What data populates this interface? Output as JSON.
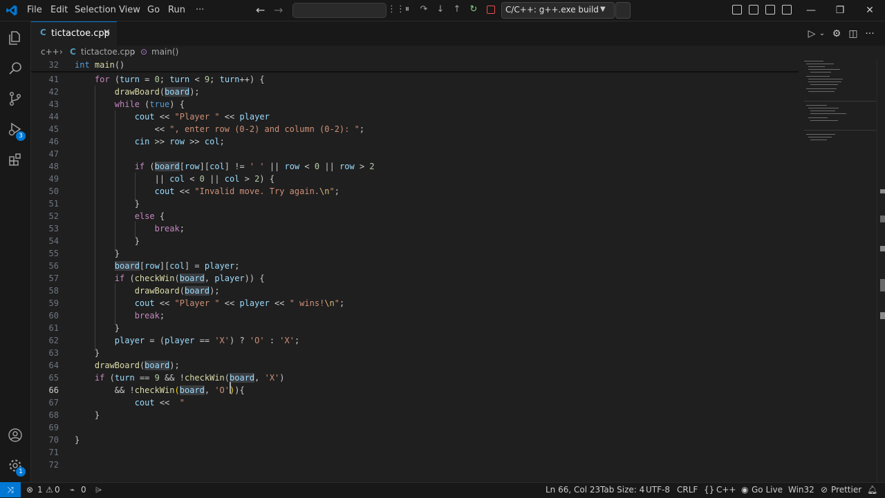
{
  "titlebar": {
    "menu": [
      "File",
      "Edit",
      "Selection",
      "View",
      "Go",
      "Run",
      "···"
    ],
    "run_config": "C/C++: g++.exe build a",
    "accent": "#0078d4"
  },
  "activity": {
    "run_debug_badge": "3",
    "manage_badge": "1"
  },
  "tab": {
    "label": "tictactoe.cpp",
    "icon": "C"
  },
  "breadcrumb": {
    "lang": "c++",
    "file": "tictactoe.cpp",
    "symbol": "main()"
  },
  "editor": {
    "sticky_line": "32",
    "line_numbers": [
      "41",
      "42",
      "43",
      "44",
      "45",
      "46",
      "47",
      "48",
      "49",
      "50",
      "51",
      "52",
      "53",
      "54",
      "55",
      "56",
      "57",
      "58",
      "59",
      "60",
      "61",
      "62",
      "63",
      "64",
      "65",
      "66",
      "67",
      "68",
      "69",
      "70",
      "71",
      "72"
    ],
    "current_line": "66"
  },
  "statusbar": {
    "errors": "1",
    "warnings": "0",
    "info": "0",
    "position": "Ln 66, Col 23",
    "tab_size": "Tab Size: 4",
    "encoding": "UTF-8",
    "eol": "CRLF",
    "language": "C++",
    "go_live": "Go Live",
    "platform": "Win32",
    "prettier": "Prettier"
  }
}
